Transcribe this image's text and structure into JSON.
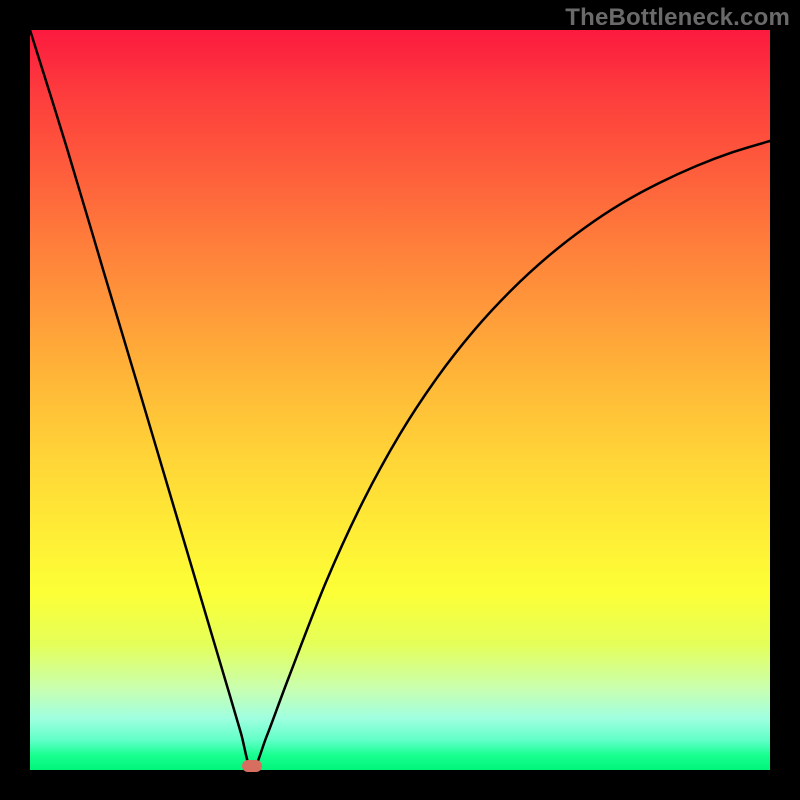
{
  "watermark": "TheBottleneck.com",
  "chart_data": {
    "type": "line",
    "title": "",
    "xlabel": "",
    "ylabel": "",
    "xlim": [
      0,
      100
    ],
    "ylim": [
      0,
      100
    ],
    "grid": false,
    "legend": false,
    "series": [
      {
        "name": "curve",
        "color": "#000000",
        "x": [
          0,
          5,
          10,
          15,
          18,
          21,
          24,
          27,
          28.5,
          30,
          32,
          35,
          40,
          45,
          50,
          55,
          60,
          65,
          70,
          75,
          80,
          85,
          90,
          95,
          100
        ],
        "values": [
          100,
          84,
          67.2,
          50.5,
          40.4,
          30.3,
          20.2,
          10.1,
          5.0,
          0,
          4.6,
          12.6,
          25.4,
          36.3,
          45.4,
          53.0,
          59.4,
          64.8,
          69.4,
          73.3,
          76.6,
          79.3,
          81.6,
          83.5,
          85.0
        ]
      }
    ],
    "marker": {
      "x": 30,
      "y": 0.6,
      "color": "#d66f5f"
    },
    "gradient_stops": [
      {
        "pos": 0,
        "color": "#fc1a3f"
      },
      {
        "pos": 50,
        "color": "#ffca37"
      },
      {
        "pos": 100,
        "color": "#00f57a"
      }
    ]
  }
}
